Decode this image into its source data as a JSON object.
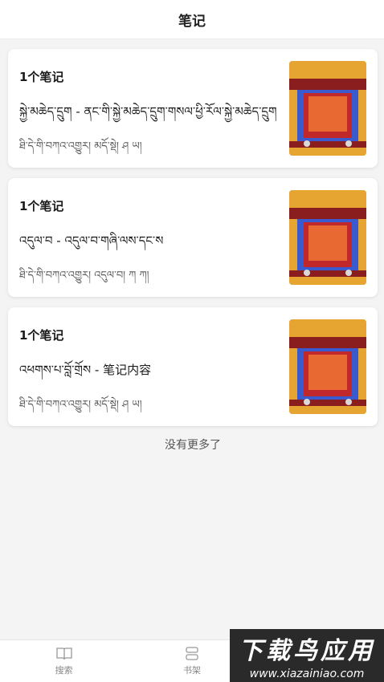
{
  "header": {
    "title": "笔记"
  },
  "notes": [
    {
      "count": "1个笔记",
      "title": "སྐྱེ་མཆེད་དྲུག - ནང་གི་སྐྱེ་མཆེད་དྲུག་གསལ་ཕྱི་རོལ་སྐྱེ་མཆེད་དྲུག",
      "meta": "ཐི་དེ་གི་བཀའ་འགྱུར། མདོ་སྡེ། ཤ ཡ།"
    },
    {
      "count": "1个笔记",
      "title": "འདུལ་བ - འདུལ་བ་གཞི་ལས་དང་ས",
      "meta": "ཐི་དེ་གི་བཀའ་འགྱུར། འདུལ་བ། ཀ ཀ།"
    },
    {
      "count": "1个笔记",
      "title": "འཕགས་པ་བློ་གྲོས - 笔记内容",
      "meta": "ཐི་དེ་གི་བཀའ་འགྱུར། མདོ་སྡེ། ཤ ཡ།"
    }
  ],
  "footer": {
    "no_more": "没有更多了"
  },
  "tabs": [
    {
      "label": "搜索",
      "icon": "book-icon"
    },
    {
      "label": "书架",
      "icon": "shelf-icon"
    }
  ],
  "watermark": {
    "big": "下载鸟应用",
    "small": "www.xiazainiao.com"
  },
  "colors": {
    "cover_gold": "#e5a530",
    "cover_red": "#c0282c",
    "cover_blue": "#3a5bd0"
  }
}
